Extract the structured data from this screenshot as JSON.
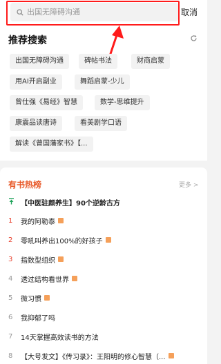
{
  "search": {
    "placeholder": "出国无障碍沟通",
    "cancel_label": "取消"
  },
  "hot_search": {
    "title": "推荐搜索",
    "chips": [
      "出国无障碍沟通",
      "碑帖书法",
      "财商启蒙",
      "用AI开启副业",
      "舞蹈启蒙-少儿",
      "曾仕强《易经》智慧",
      "数学-思维提升",
      "康震品读唐诗",
      "看美剧学口语",
      "解读《曾国藩家书》【..."
    ]
  },
  "ranking": {
    "title": "有书热榜",
    "more_label": "更多 >",
    "pinned": "【中医驻颜养生】90个逆龄古方",
    "items": [
      {
        "num": "1",
        "text": "我的阿勒泰",
        "tag": true
      },
      {
        "num": "2",
        "text": "零吼叫养出100%的好孩子",
        "tag": true
      },
      {
        "num": "3",
        "text": "指数型组织",
        "tag": true
      },
      {
        "num": "4",
        "text": "透过结构看世界",
        "tag": true
      },
      {
        "num": "5",
        "text": "微习惯",
        "tag": true
      },
      {
        "num": "6",
        "text": "我抑郁了吗",
        "tag": false
      },
      {
        "num": "7",
        "text": "14天掌握高效读书的方法",
        "tag": false
      },
      {
        "num": "8",
        "text": "【大号发文】《传习录》：王阳明的修心智慧（...",
        "tag": true
      }
    ]
  },
  "colors": {
    "highlight": "#ff1b1b",
    "rank_hot": "#e8412e",
    "rank_title": "#e85a2a",
    "tag": "#f5a05a"
  }
}
